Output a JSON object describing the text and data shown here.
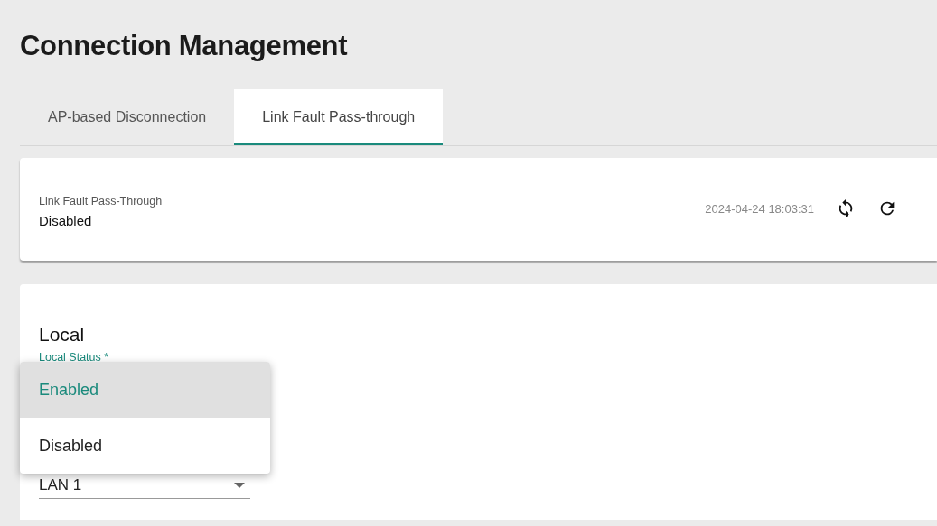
{
  "page": {
    "title": "Connection Management"
  },
  "tabs": [
    {
      "label": "AP-based Disconnection",
      "selected": false
    },
    {
      "label": "Link Fault Pass-through",
      "selected": true
    }
  ],
  "status_card": {
    "label": "Link Fault Pass-Through",
    "value": "Disabled",
    "timestamp": "2024-04-24 18:03:31"
  },
  "local_section": {
    "heading": "Local",
    "status_field": {
      "label": "Local Status *"
    },
    "interface_field": {
      "value": "LAN 1"
    }
  },
  "dropdown_menu": {
    "options": [
      {
        "label": "Enabled",
        "selected": true
      },
      {
        "label": "Disabled",
        "selected": false
      }
    ]
  }
}
